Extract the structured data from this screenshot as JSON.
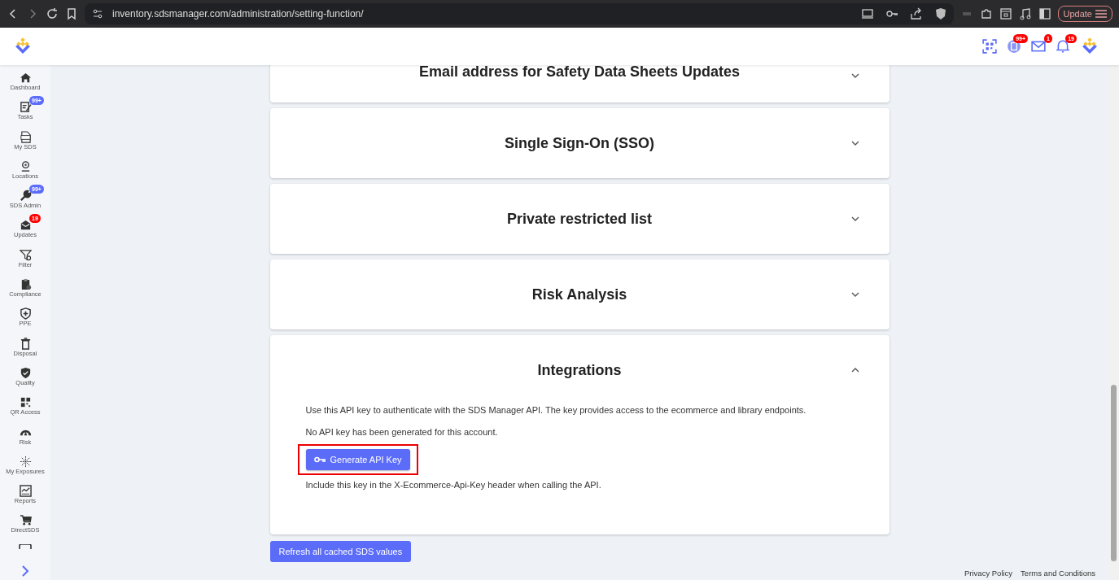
{
  "browser": {
    "url": "inventory.sdsmanager.com/administration/setting-function/",
    "update_button": "Update"
  },
  "header": {
    "badges": [
      {
        "text": "99+",
        "color": "#ff0000"
      },
      {
        "text": "1",
        "color": "#ff0000"
      },
      {
        "text": "19",
        "color": "#ff0000"
      }
    ]
  },
  "sidebar": {
    "items": [
      {
        "label": "Dashboard"
      },
      {
        "label": "Tasks",
        "badge": "99+",
        "color": "#5b6cf9"
      },
      {
        "label": "My SDS"
      },
      {
        "label": "Locations"
      },
      {
        "label": "SDS Admin",
        "badge": "99+",
        "color": "#5b6cf9"
      },
      {
        "label": "Updates",
        "badge": "19",
        "color": "#ff0000"
      },
      {
        "label": "Filter"
      },
      {
        "label": "Compliance"
      },
      {
        "label": "PPE"
      },
      {
        "label": "Disposal"
      },
      {
        "label": "Quality"
      },
      {
        "label": "QR Access"
      },
      {
        "label": "Risk"
      },
      {
        "label": "My Exposures"
      },
      {
        "label": "Reports"
      },
      {
        "label": "DirectSDS"
      }
    ]
  },
  "panels": [
    {
      "title": "Email address for Safety Data Sheets Updates",
      "expanded": false
    },
    {
      "title": "Single Sign-On (SSO)",
      "expanded": false
    },
    {
      "title": "Private restricted list",
      "expanded": false
    },
    {
      "title": "Risk Analysis",
      "expanded": false
    },
    {
      "title": "Integrations",
      "expanded": true,
      "body": {
        "description": "Use this API key to authenticate with the SDS Manager API. The key provides access to the ecommerce and library endpoints.",
        "status": "No API key has been generated for this account.",
        "button": "Generate API Key",
        "highlighted": true,
        "hint": "Include this key in the X-Ecommerce-Api-Key header when calling the API."
      }
    }
  ],
  "refresh_button": "Refresh all cached SDS values",
  "footer": {
    "links": [
      "Privacy Policy",
      "Terms and Conditions"
    ]
  }
}
